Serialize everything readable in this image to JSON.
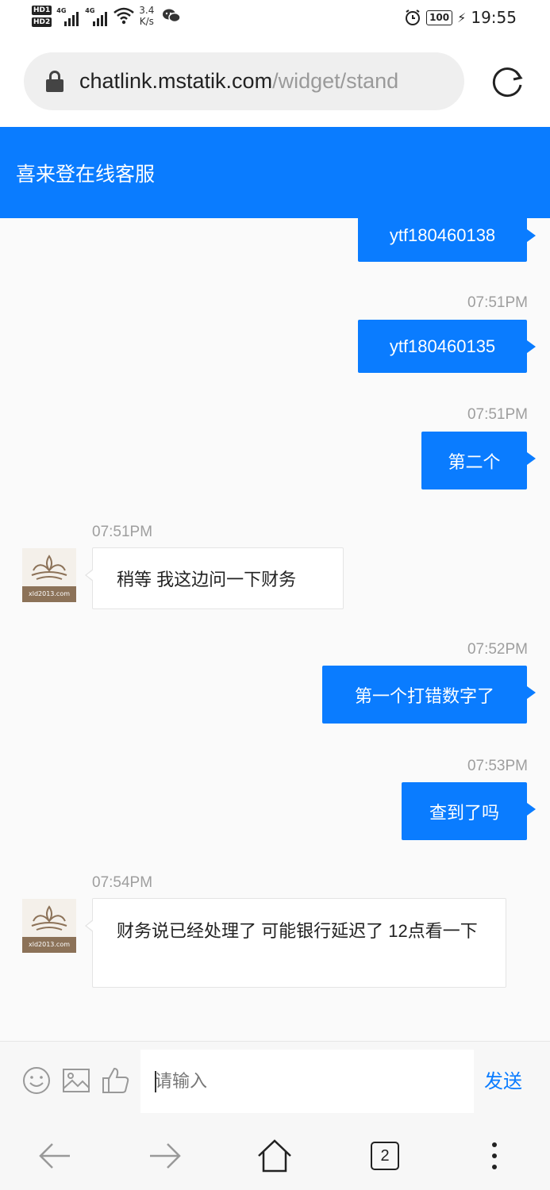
{
  "status_bar": {
    "speed_value": "3.4",
    "speed_unit": "K/s",
    "battery": "100",
    "time": "19:55",
    "signal_label": "4G",
    "hd_label_1": "HD1",
    "hd_label_2": "HD2"
  },
  "browser": {
    "url_host": "chatlink.mstatik.com",
    "url_path": "/widget/stand",
    "open_tabs": "2"
  },
  "chat": {
    "title": "喜来登在线客服",
    "avatar_caption": "xld2013.com",
    "messages": [
      {
        "side": "right",
        "text": "ytf180460138"
      },
      {
        "side": "right",
        "time": "07:51PM",
        "text": "ytf180460135"
      },
      {
        "side": "right",
        "time": "07:51PM",
        "text": "第二个"
      },
      {
        "side": "left",
        "time": "07:51PM",
        "text": "稍等 我这边问一下财务"
      },
      {
        "side": "right",
        "time": "07:52PM",
        "text": "第一个打错数字了"
      },
      {
        "side": "right",
        "time": "07:53PM",
        "text": "查到了吗"
      },
      {
        "side": "left",
        "time": "07:54PM",
        "text": "财务说已经处理了 可能银行延迟了 12点看一下"
      }
    ]
  },
  "input": {
    "placeholder": "请输入",
    "send_label": "发送"
  },
  "colors": {
    "accent": "#0a7cff",
    "chat_bg": "#fafafa"
  }
}
